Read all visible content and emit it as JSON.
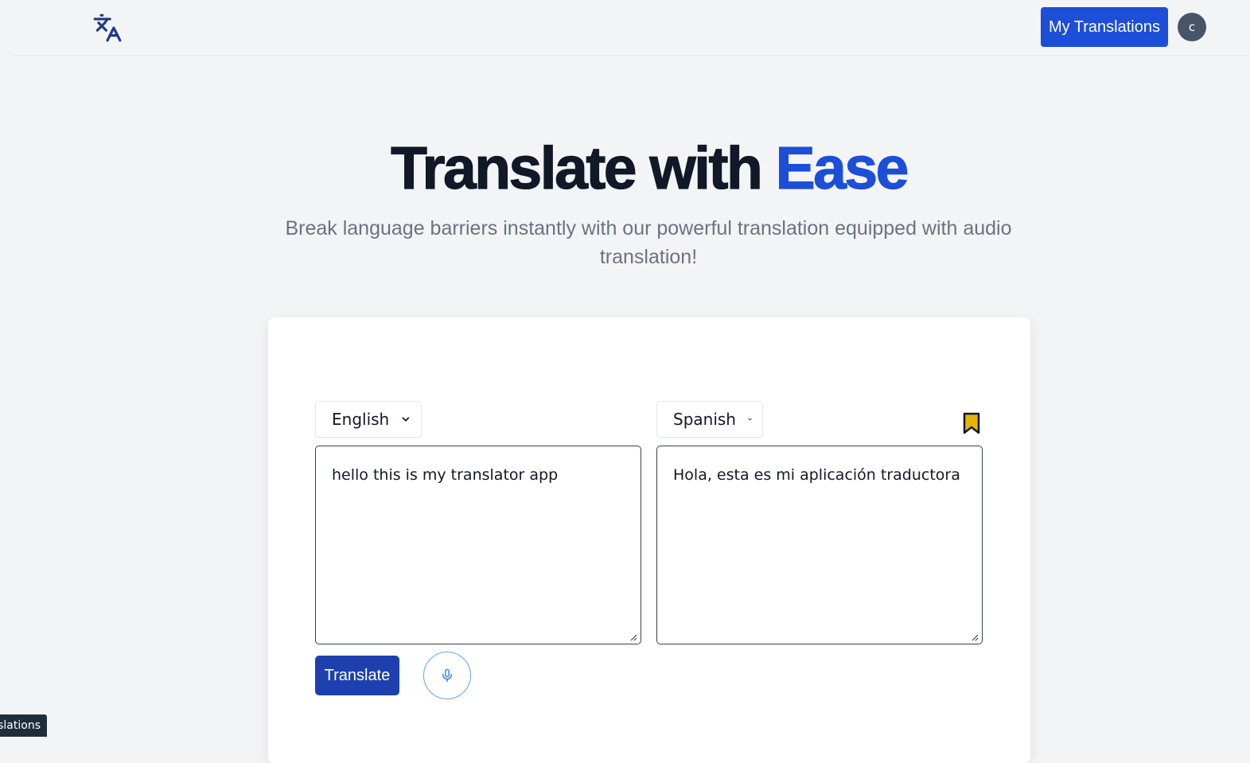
{
  "nav": {
    "logo_icon": "translate-icon",
    "my_translations_label": "My Translations",
    "avatar_initial": "c"
  },
  "hero": {
    "title_main": "Translate with ",
    "title_accent": "Ease",
    "subtitle": "Break language barriers instantly with our powerful translation equipped with audio translation!"
  },
  "translator": {
    "source_language": "English",
    "target_language": "Spanish",
    "source_text": "hello this is my translator app",
    "target_text": "Hola, esta es mi aplicación traductora",
    "translate_label": "Translate",
    "mic_icon": "microphone-icon",
    "bookmark_icon": "bookmark-icon"
  },
  "tooltip": {
    "text": "slations"
  },
  "colors": {
    "accent": "#1d4ed8",
    "bookmark_fill": "#eab308",
    "page_bg": "#f3f4f6"
  }
}
